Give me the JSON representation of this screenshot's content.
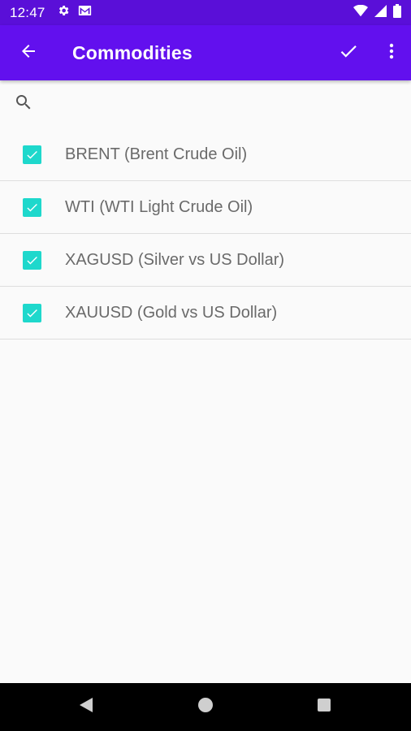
{
  "status_bar": {
    "time": "12:47",
    "icons_left": [
      "gear-icon",
      "gmail-icon"
    ],
    "icons_right": [
      "wifi-icon",
      "signal-icon",
      "battery-icon"
    ],
    "color": "#5a0fd8"
  },
  "app_bar": {
    "title": "Commodities",
    "back_icon": "arrow-back-icon",
    "confirm_icon": "check-icon",
    "menu_icon": "more-vert-icon",
    "color": "#6210ee"
  },
  "search": {
    "icon": "search-icon",
    "placeholder": ""
  },
  "items": [
    {
      "label": "BRENT (Brent Crude Oil)",
      "checked": true
    },
    {
      "label": "WTI (WTI Light Crude Oil)",
      "checked": true
    },
    {
      "label": "XAGUSD (Silver vs US Dollar)",
      "checked": true
    },
    {
      "label": "XAUUSD (Gold vs US Dollar)",
      "checked": true
    }
  ],
  "checkbox_color": "#1ed8cc",
  "nav_bar": {
    "icons": [
      "back-triangle-icon",
      "home-circle-icon",
      "recents-square-icon"
    ]
  }
}
